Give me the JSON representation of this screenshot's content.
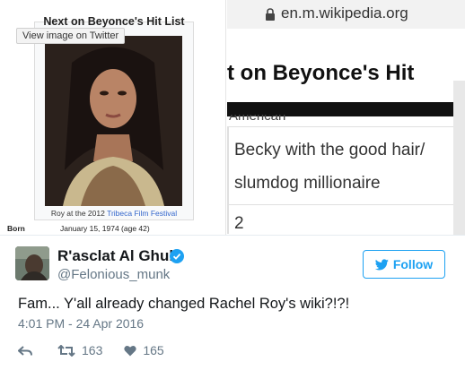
{
  "media": {
    "view_on_twitter": "View image on Twitter",
    "wiki_left": {
      "heading": "Next on Beyonce's Hit List",
      "caption_prefix": "Roy at the 2012 ",
      "caption_link": "Tribeca Film Festival",
      "born_label": "Born",
      "born_value": "January 15, 1974 (age 42)"
    },
    "wiki_right": {
      "url": "en.m.wikipedia.org",
      "heading": "t on Beyonce's Hit",
      "cut_text": "American",
      "spouse_line1": "Becky with the good hair/",
      "spouse_line2": "slumdog millionaire",
      "children": "2"
    }
  },
  "tweet": {
    "display_name": "R'asclat Al Ghul",
    "handle": "@Felonious_munk",
    "follow_label": "Follow",
    "text": "Fam... Y'all already changed Rachel Roy's wiki?!?!",
    "timestamp": "4:01 PM - 24 Apr 2016",
    "retweets": "163",
    "likes": "165"
  },
  "colors": {
    "twitter_blue": "#1da1f2",
    "wiki_link": "#3366cc",
    "secondary_text": "#657786"
  },
  "icons": [
    "lock-icon",
    "verified-icon",
    "bird-icon",
    "reply-icon",
    "retweet-icon",
    "heart-icon"
  ]
}
